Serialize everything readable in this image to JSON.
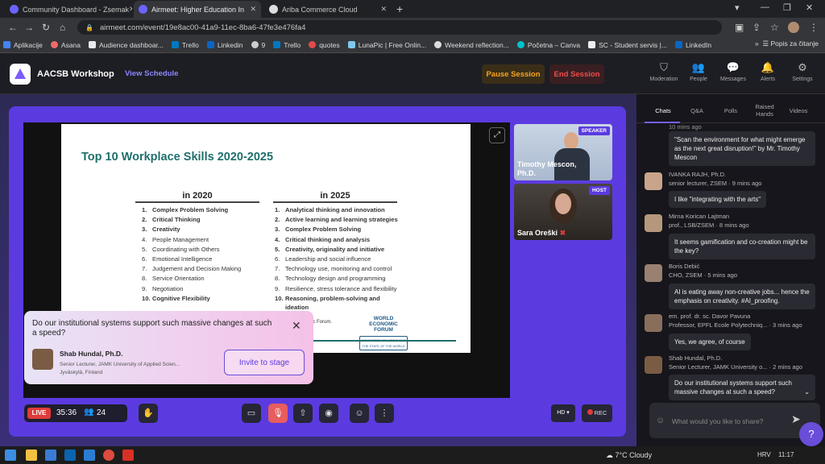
{
  "browser": {
    "tabs": [
      {
        "label": "Community Dashboard - Zsemak",
        "active": false
      },
      {
        "label": "Airmeet: Higher Education In",
        "active": true
      },
      {
        "label": "Ariba Commerce Cloud",
        "active": false
      }
    ],
    "url": "airmeet.com/event/19e8ac00-41a9-11ec-8ba6-47fe3e476fa4",
    "bookmarks": [
      "Aplikacije",
      "Asana",
      "Audience dashboar...",
      "Trello",
      "Linkedin",
      "9",
      "Trello",
      "quotes",
      "LunaPic | Free Onlin...",
      "Weekend reflection...",
      "Početna – Canva",
      "SC - Student servis |...",
      "LinkedIn"
    ],
    "reading_list": "Popis za čitanje"
  },
  "header": {
    "event_title": "AACSB Workshop",
    "view_schedule": "View Schedule",
    "pause_label": "Pause Session",
    "end_label": "End Session",
    "nav": [
      "Moderation",
      "People",
      "Messages",
      "Alerts",
      "Settings"
    ]
  },
  "slide": {
    "title": "Top 10 Workplace Skills 2020-2025",
    "col2020_title": "in 2020",
    "col2025_title": "in 2025",
    "skills2020": [
      {
        "n": "1.",
        "t": "Complex Problem Solving",
        "bold": true
      },
      {
        "n": "2.",
        "t": "Critical Thinking",
        "bold": true
      },
      {
        "n": "3.",
        "t": "Creativity",
        "bold": true
      },
      {
        "n": "4.",
        "t": "People Management",
        "bold": false
      },
      {
        "n": "5.",
        "t": "Coordinating with Others",
        "bold": false
      },
      {
        "n": "6.",
        "t": "Emotional Intelligence",
        "bold": false
      },
      {
        "n": "7.",
        "t": "Judgement and Decision Making",
        "bold": false
      },
      {
        "n": "8.",
        "t": "Service Orientation",
        "bold": false
      },
      {
        "n": "9.",
        "t": "Negotiation",
        "bold": false
      },
      {
        "n": "10.",
        "t": "Cognitive Flexibility",
        "bold": true
      }
    ],
    "skills2025": [
      {
        "n": "1.",
        "t": "Analytical thinking and innovation",
        "bold": true
      },
      {
        "n": "2.",
        "t": "Active learning and learning strategies",
        "bold": true
      },
      {
        "n": "3.",
        "t": "Complex Problem Solving",
        "bold": true
      },
      {
        "n": "4.",
        "t": "Critical thinking and analysis",
        "bold": true
      },
      {
        "n": "5.",
        "t": "Creativity, originality and initiative",
        "bold": true
      },
      {
        "n": "6.",
        "t": "Leadership and social influence",
        "bold": false
      },
      {
        "n": "7.",
        "t": "Technology use, monitoring and control",
        "bold": false
      },
      {
        "n": "8.",
        "t": "Technology design and programming",
        "bold": false
      },
      {
        "n": "9.",
        "t": "Resilience, stress tolerance and flexibility",
        "bold": false
      },
      {
        "n": "10.",
        "t": "Reasoning, problem-solving and",
        "bold": true
      }
    ],
    "skill2025_10_cont": "ideation",
    "source": "onomic Forum.",
    "wef_logo": "WORLD ECONOMIC FORUM",
    "wef_tagline": "COMMITTED TO IMPROVING THE STATE OF THE WORLD"
  },
  "speakers": [
    {
      "name": "Timothy Mescon, Ph.D.",
      "badge": "SPEAKER"
    },
    {
      "name": "Sara Oreški",
      "badge": "HOST"
    }
  ],
  "toast": {
    "question": "Do our institutional systems support such massive changes at such a speed?",
    "asker_name": "Shab Hundal, Ph.D.",
    "asker_role": "Senior Lecturer, JAMK University of Applied Scien...",
    "asker_location": "Jyväskylä, Finland",
    "invite_label": "Invite to stage"
  },
  "controls": {
    "live": "LIVE",
    "timer": "35:36",
    "attendees": "24",
    "hd": "HD",
    "rec": "REC"
  },
  "sidebar": {
    "tabs": [
      "Chats",
      "Q&A",
      "Polls",
      "Raised Hands",
      "Videos"
    ],
    "top_time": "10 mins ago",
    "messages": [
      {
        "meta": "",
        "text": "\"Scan the environment for what might emerge as the next great disruption!\" by Mr. Timothy Mescon"
      },
      {
        "meta": "IVANKA RAJH, Ph.D.",
        "meta2": "senior lecturer, ZSEM · 9 mins ago",
        "text": "I like \"integrating with the arts\""
      },
      {
        "meta": "Mirna Korican Lajtman",
        "meta2": "prof., LSB/ZSEM · 8 mins ago",
        "text": "It seems gamification and co-creation might be the key?"
      },
      {
        "meta": "Boris Debić",
        "meta2": "CHO, ZSEM · 5 mins ago",
        "text": "AI is eating away non-creative jobs... hence the emphasis on creativity. #AI_proofing."
      },
      {
        "meta": "em. prof. dr. sc. Davor Pavuna",
        "meta2": "Professor, EPFL Ecole Polytechniq... · 3 mins ago",
        "text": "Yes, we agree, of course"
      },
      {
        "meta": "Shab Hundal, Ph.D.",
        "meta2": "Senior Lecturer, JAMK University o... · 2 mins ago",
        "text": "Do our institutional systems support such massive changes at such a speed?"
      }
    ],
    "input_placeholder": "What would you like to share?"
  },
  "taskbar": {
    "weather": "7°C  Cloudy",
    "lang": "HRV",
    "time": "11:17"
  },
  "colors": {
    "accent": "#5b3be0",
    "live": "#e03b3b",
    "pause": "#f6a321",
    "end": "#ee4c4c"
  }
}
